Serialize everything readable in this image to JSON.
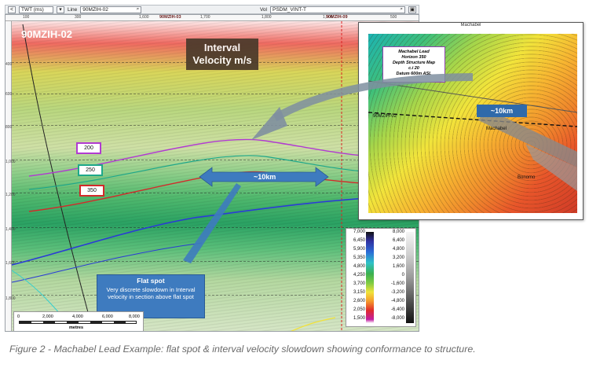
{
  "toolbar": {
    "back_glyph": "<",
    "domain_select": "TWT (ms)",
    "line_label": "Line",
    "line_value": "90MZIH-02",
    "vol_label": "Vol",
    "vol_value": "PSDM_VINT-T"
  },
  "section": {
    "well_title": "90MZIH-02",
    "interval_title_l1": "Interval",
    "interval_title_l2": "Velocity m/s",
    "well_markers": [
      "90MZIH-03",
      "90MZIH-09"
    ],
    "depth_ticks": [
      "400",
      "600",
      "800",
      "1,000",
      "1,200",
      "1,400",
      "1,600",
      "1,800"
    ],
    "cdp_ticks": [
      "100",
      "300",
      "1,600",
      "1,700",
      "1,800",
      "1,900",
      "1,100",
      "500"
    ],
    "horizons": [
      {
        "label": "200",
        "color": "#b13bd1"
      },
      {
        "label": "250",
        "color": "#1ea88a"
      },
      {
        "label": "350",
        "color": "#d22a2a"
      }
    ],
    "km_label": "~10km",
    "flatspot_title": "Flat spot",
    "flatspot_body": "Very discrete slowdown in Interval velocity in section above flat spot",
    "scale_numbers": [
      "0",
      "2,000",
      "4,000",
      "6,000",
      "8,000"
    ],
    "scale_unit": "metres"
  },
  "colorbar_velocity": [
    "7,000",
    "6,450",
    "5,900",
    "5,350",
    "4,800",
    "4,250",
    "3,700",
    "3,150",
    "2,600",
    "2,050",
    "1,500"
  ],
  "colorbar_amplitude": [
    "8,000",
    "6,400",
    "4,800",
    "3,200",
    "1,600",
    "0",
    "-1,600",
    "-3,200",
    "-4,800",
    "-6,400",
    "-8,000"
  ],
  "inset": {
    "top_label": "Machabel",
    "legend_l1": "Machabel Lead",
    "legend_l2": "Horizon 350",
    "legend_l3": "Depth Structure Map",
    "legend_l4": "c.i 20",
    "legend_l5": "Datum 600m ASL",
    "well_label": "90MZIH-02",
    "machabel_label": "Machabel",
    "bonomo_label": "Bonomo",
    "km_label": "~10km"
  },
  "caption": "Figure 2 - Machabel Lead Example: flat spot & interval velocity slowdown showing conformance to structure."
}
